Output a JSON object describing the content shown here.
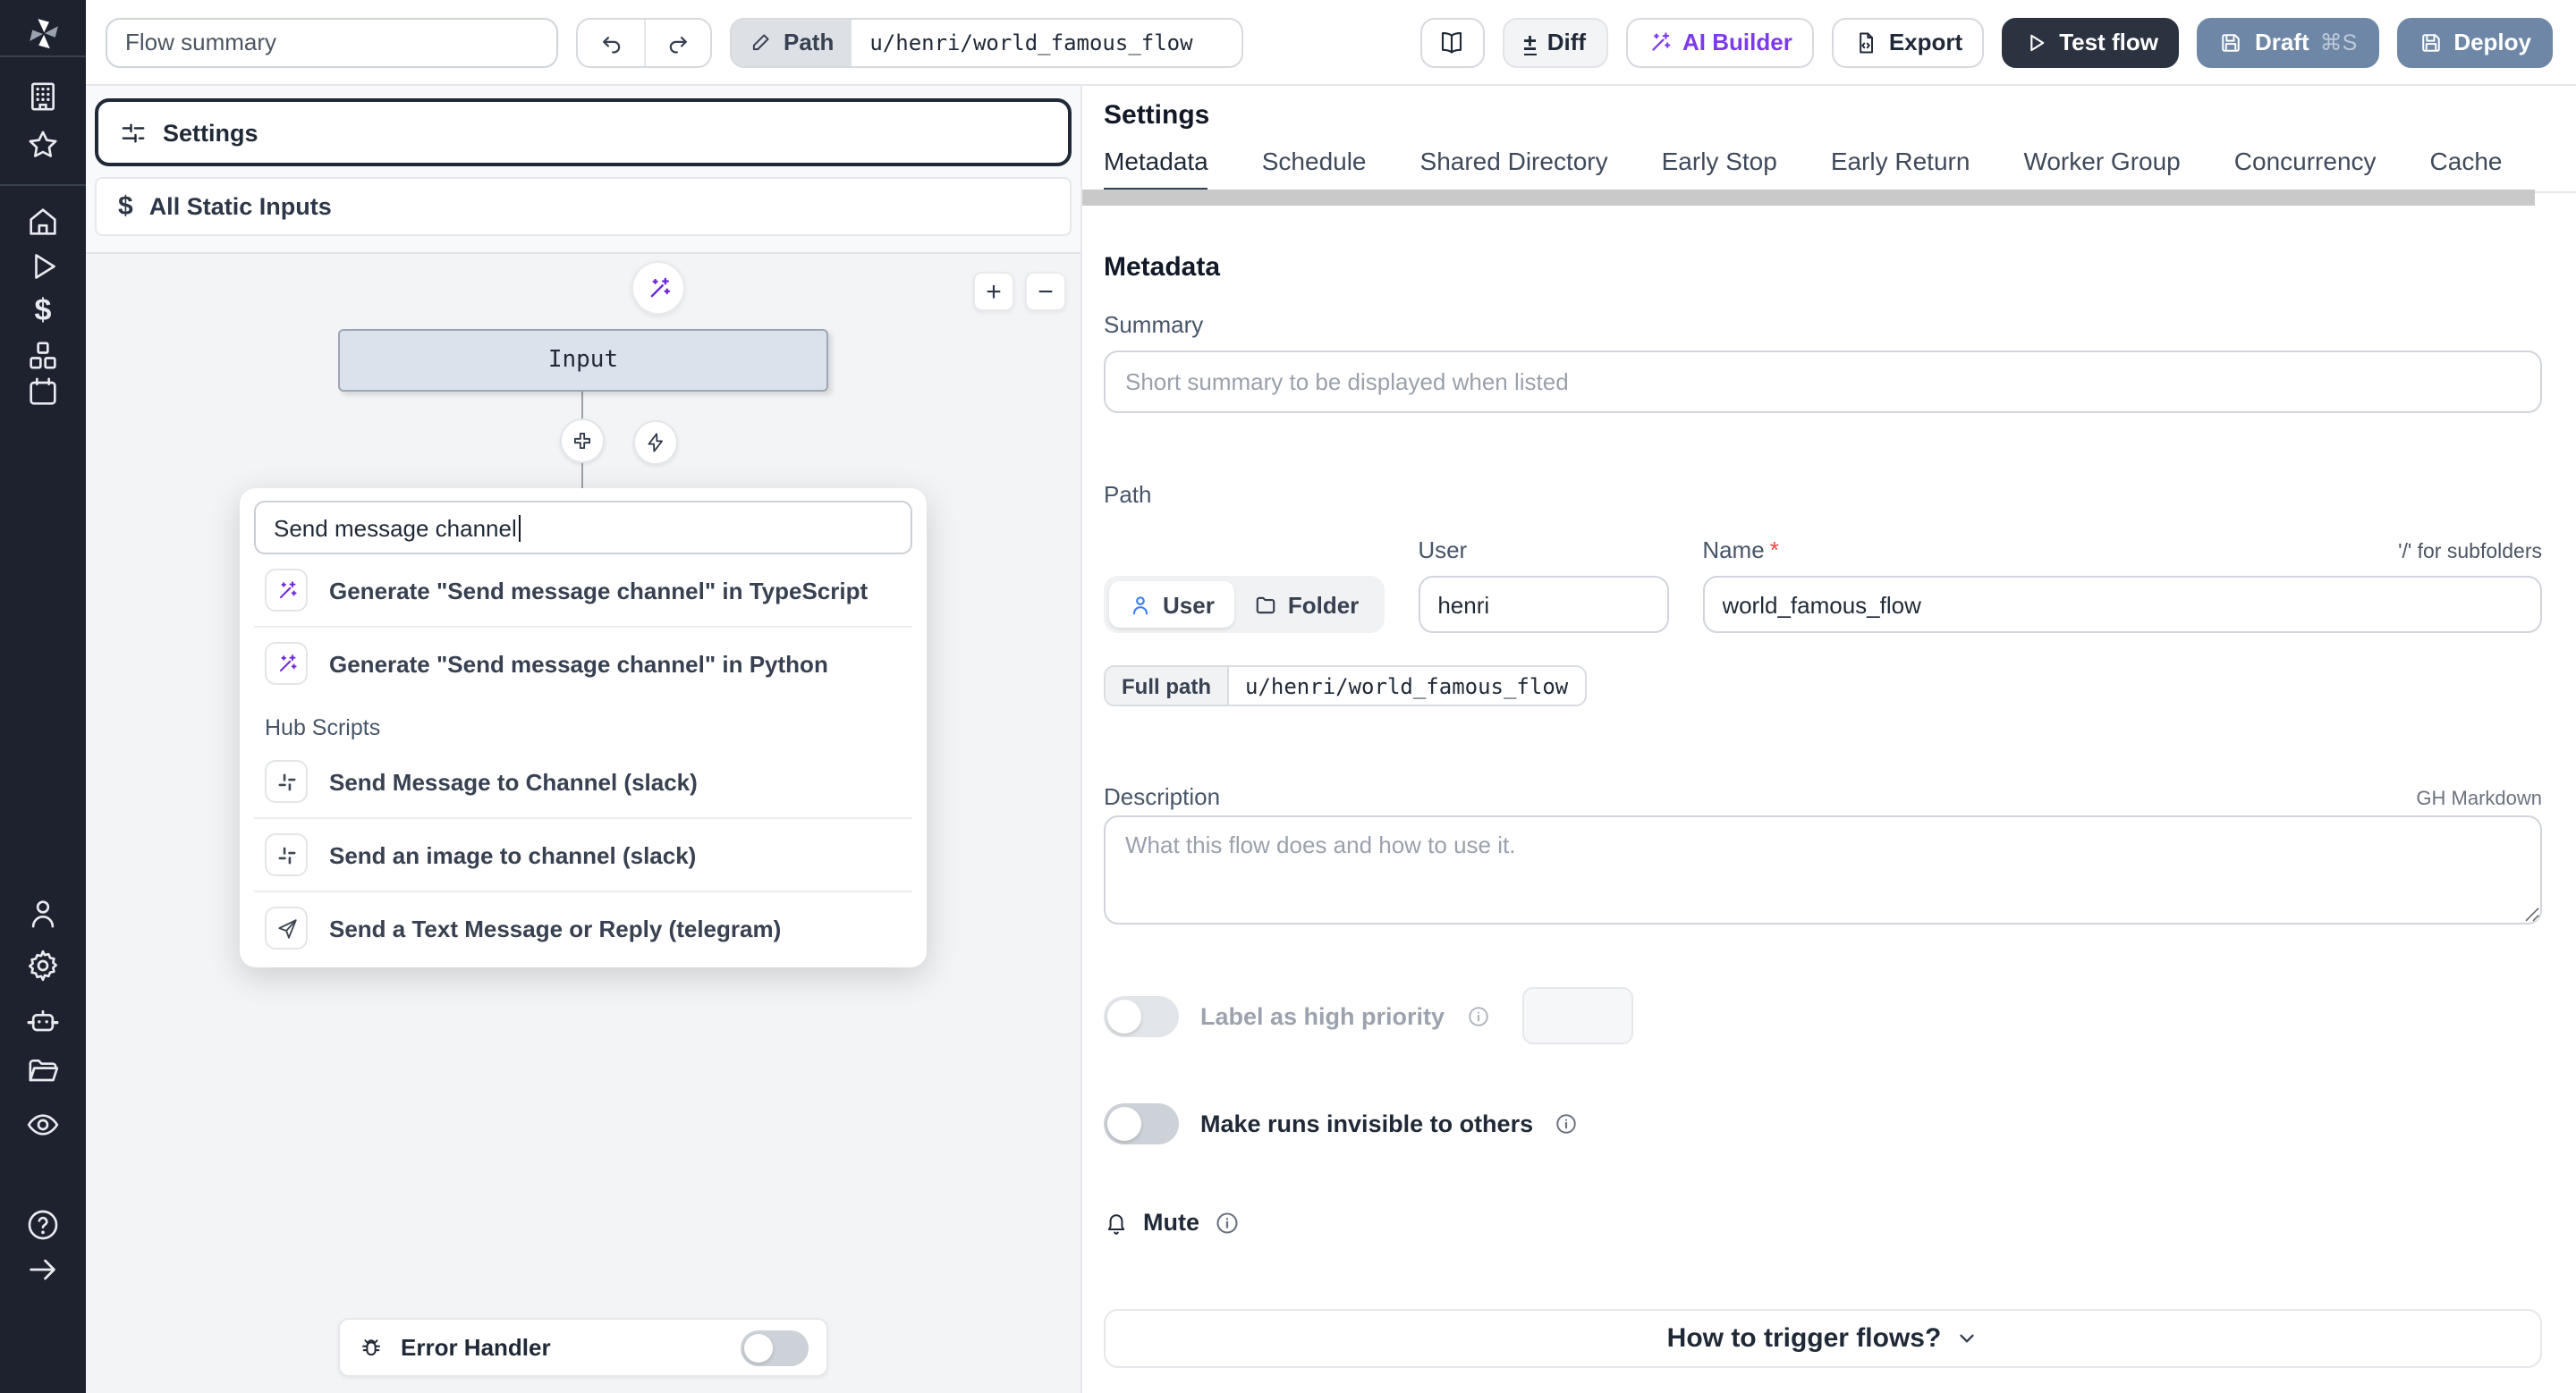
{
  "topbar": {
    "flow_summary_placeholder": "Flow summary",
    "path_label": "Path",
    "path_value": "u/henri/world_famous_flow",
    "diff_label": "Diff",
    "ai_builder_label": "AI Builder",
    "export_label": "Export",
    "test_flow_label": "Test flow",
    "draft_label": "Draft",
    "draft_shortcut": "⌘S",
    "deploy_label": "Deploy"
  },
  "flow_panel": {
    "settings_button_label": "Settings",
    "static_inputs_label": "All Static Inputs",
    "input_node_label": "Input",
    "zoom_in_label": "+",
    "zoom_out_label": "−",
    "search_value": "Send message channel",
    "generate_items": [
      {
        "icon": "wand-icon",
        "label": "Generate \"Send message channel\" in TypeScript"
      },
      {
        "icon": "wand-icon",
        "label": "Generate \"Send message channel\" in Python"
      }
    ],
    "hub_section_label": "Hub Scripts",
    "hub_items": [
      {
        "icon": "slack-icon",
        "label": "Send Message to Channel (slack)"
      },
      {
        "icon": "slack-icon",
        "label": "Send an image to channel (slack)"
      },
      {
        "icon": "telegram-icon",
        "label": "Send a Text Message or Reply (telegram)"
      }
    ],
    "error_handler_label": "Error Handler"
  },
  "settings_panel": {
    "title": "Settings",
    "tabs": [
      "Metadata",
      "Schedule",
      "Shared Directory",
      "Early Stop",
      "Early Return",
      "Worker Group",
      "Concurrency",
      "Cache"
    ],
    "active_tab": "Metadata",
    "metadata": {
      "heading": "Metadata",
      "summary_label": "Summary",
      "summary_placeholder": "Short summary to be displayed when listed",
      "path_label": "Path",
      "owner_user_label": "User",
      "owner_folder_label": "Folder",
      "user_label": "User",
      "user_value": "henri",
      "name_label": "Name",
      "name_required_mark": "*",
      "subfolders_hint": "'/' for subfolders",
      "full_path_label": "Full path",
      "full_path_value": "u/henri/world_famous_flow",
      "description_label": "Description",
      "markdown_hint": "GH Markdown",
      "description_placeholder": "What this flow does and how to use it.",
      "high_priority_label": "Label as high priority",
      "invisible_runs_label": "Make runs invisible to others",
      "mute_label": "Mute",
      "trigger_help_label": "How to trigger flows?"
    }
  },
  "colors": {
    "sidebar_bg": "#1d222e",
    "accent_purple": "#7c3aed",
    "dark_button": "#2b3340",
    "slate_button": "#6e87a6",
    "graph_bg": "#f3f4f6"
  }
}
